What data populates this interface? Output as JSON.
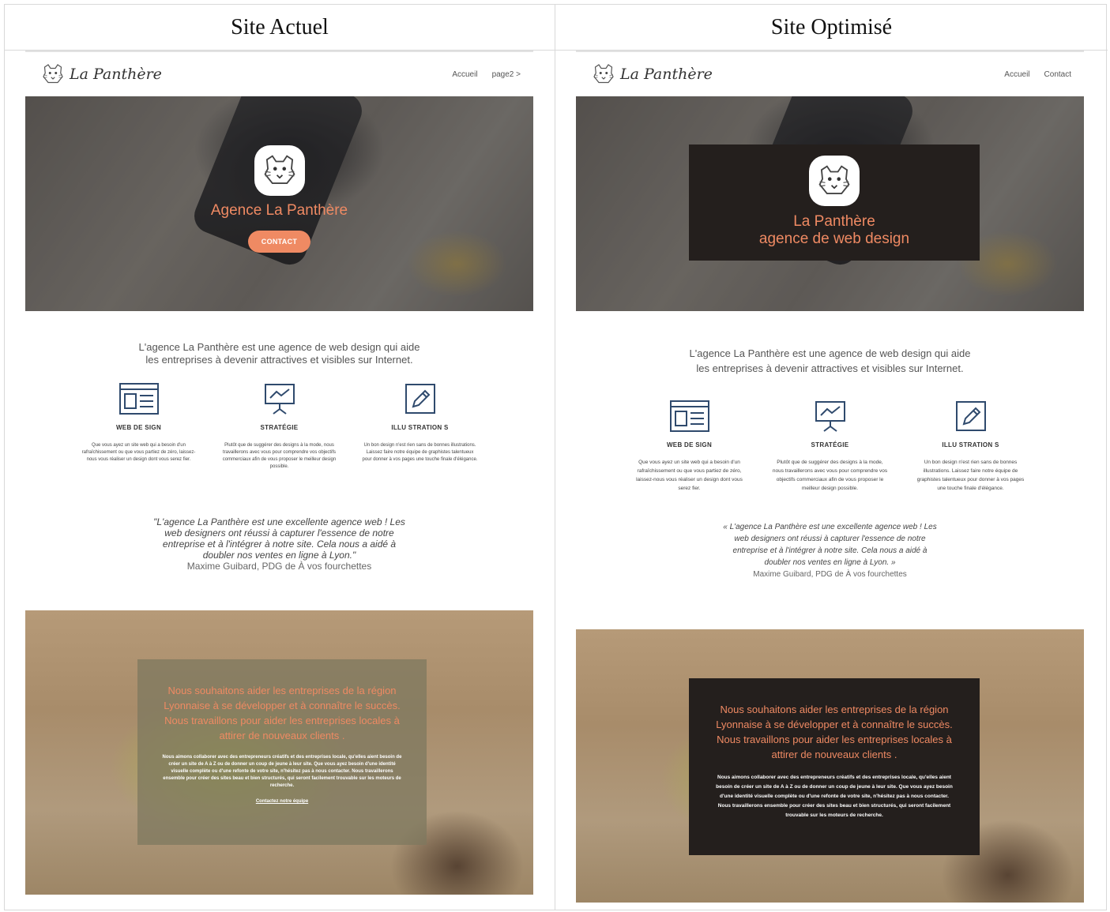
{
  "headers": {
    "left": "Site Actuel",
    "right": "Site Optimisé"
  },
  "brand": {
    "name": "La Panthère",
    "logo_icon": "panther-logo-icon"
  },
  "left": {
    "nav": {
      "link1": "Accueil",
      "link2": "page2 >"
    },
    "hero": {
      "title": "Agence La Panthère",
      "button": "CONTACT"
    },
    "intro_line1": "L'agence La Panthère est une agence de web design qui aide",
    "intro_line2": "les entreprises à devenir attractives et visibles sur Internet.",
    "features": [
      {
        "icon": "web-design-icon",
        "title": "WEB DE SIGN",
        "text": "Que vous ayez un site web qui a besoin d'un rafraîchissement ou que vous partiez de zéro, laissez-nous vous réaliser un design dont vous serez fier."
      },
      {
        "icon": "presentation-chart-icon",
        "title": "STRATÉGIE",
        "text": "Plutôt que de suggérer des designs à la mode, nous travaillerons avec vous pour comprendre vos objectifs commerciaux afin de vous proposer le meilleur design possible."
      },
      {
        "icon": "pencil-icon",
        "title": "ILLU STRATION S",
        "text": "Un bon design n'est rien sans de bonnes illustrations. Laissez faire notre équipe de graphistes talentueux pour donner à vos pages une touche finale d'élégance."
      }
    ],
    "quote": [
      "\"L'agence La Panthère est une excellente agence web ! Les",
      "web designers ont réussi à capturer l'essence de notre",
      "entreprise et à l'intégrer à notre site. Cela nous a aidé à",
      "doubler nos ventes en ligne à Lyon.\""
    ],
    "quote_author": "Maxime Guibard, PDG de À vos fourchettes",
    "bottom": {
      "title": "Nous souhaitons aider les entreprises de la région Lyonnaise à se développer et à connaître le succès. Nous travaillons pour aider les entreprises locales à attirer de nouveaux clients .",
      "text": "Nous aimons collaborer avec des entrepreneurs créatifs et des entreprises locale, qu'elles aient besoin de créer un site de A à Z ou de donner un coup de jeune à leur site. Que vous ayez besoin d'une identité visuelle complète ou d'une refonte de votre site, n'hésitez pas à nous contacter. Nous travaillerons ensemble pour créer des sites beau et bien structurés, qui seront facilement trouvable sur les moteurs de recherche.",
      "link": "Contactez notre équipe"
    }
  },
  "right": {
    "nav": {
      "link1": "Accueil",
      "link2": "Contact"
    },
    "hero": {
      "line1": "La Panthère",
      "line2": "agence de web design"
    },
    "intro_line1": "L'agence La Panthère est une agence de web design qui aide",
    "intro_line2": "les entreprises à devenir attractives et visibles sur Internet.",
    "features": [
      {
        "icon": "web-design-icon",
        "title": "WEB DE SIGN",
        "text": "Que vous ayez un site web qui a besoin d'un rafraîchissement ou que vous partiez de zéro, laissez-nous vous réaliser un design dont vous serez fier."
      },
      {
        "icon": "presentation-chart-icon",
        "title": "STRATÉGIE",
        "text": "Plutôt que de suggérer des designs à la mode, nous travaillerons avec vous pour comprendre vos objectifs commerciaux afin de vous proposer le meilleur design possible."
      },
      {
        "icon": "pencil-icon",
        "title": "ILLU STRATION S",
        "text": "Un bon design n'est rien sans de bonnes illustrations. Laissez faire notre équipe de graphistes talentueux pour donner à vos pages une touche finale d'élégance."
      }
    ],
    "quote": [
      "« L'agence La Panthère est une excellente agence web ! Les",
      "web designers ont réussi à capturer l'essence de notre",
      "entreprise et à l'intégrer à notre site. Cela nous a aidé à",
      "doubler nos ventes en ligne à Lyon. »"
    ],
    "quote_author": "Maxime Guibard, PDG de À vos fourchettes",
    "bottom": {
      "title": "Nous souhaitons aider les entreprises de la région Lyonnaise à se développer et à connaître le succès. Nous travaillons pour aider les entreprises locales à attirer de nouveaux clients .",
      "text": "Nous aimons collaborer avec des entrepreneurs créatifs et des entreprises locale, qu'elles aient besoin de créer un site de A à Z ou de donner un coup de jeune à leur site. Que vous ayez besoin d'une identité visuelle complète ou d'une refonte de votre site, n'hésitez pas à nous contacter. Nous travaillerons ensemble pour créer des sites beau et bien structurés, qui seront facilement trouvable sur les moteurs de recherche."
    }
  },
  "colors": {
    "accent": "#ef8a63",
    "dark_box": "#241f1d",
    "text": "#333333"
  }
}
